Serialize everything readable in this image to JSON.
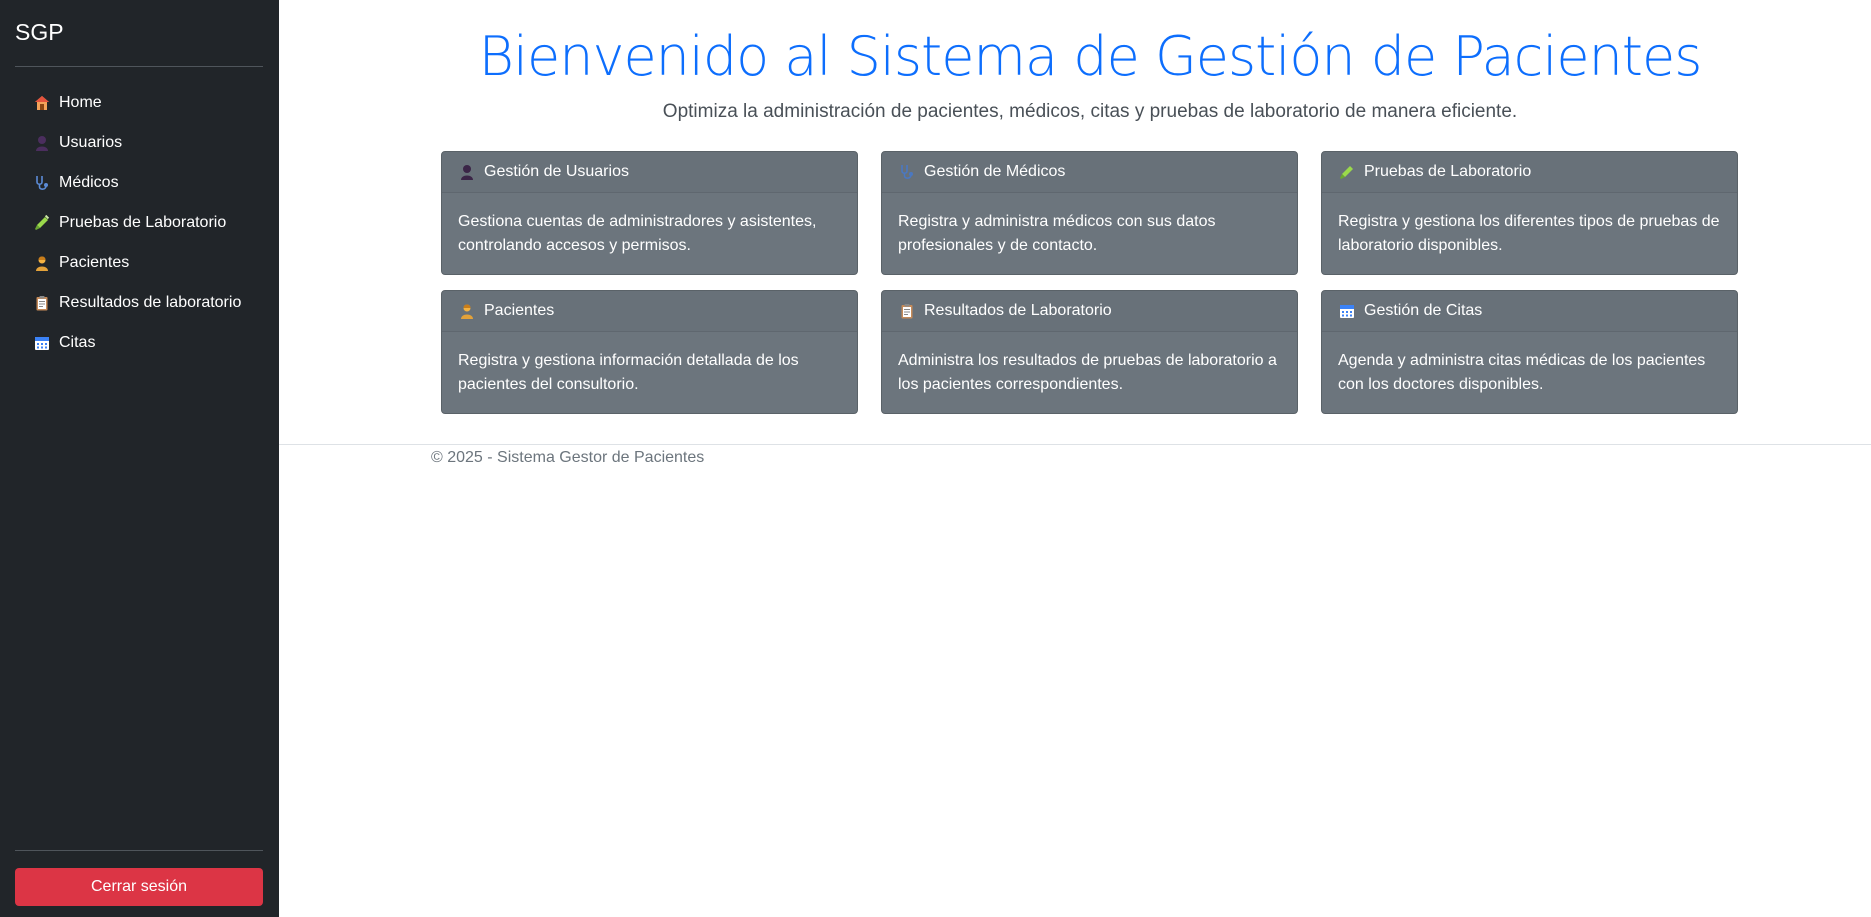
{
  "sidebar": {
    "brand": "SGP",
    "items": [
      {
        "label": "Home",
        "icon": "house-icon"
      },
      {
        "label": "Usuarios",
        "icon": "user-silhouette-icon"
      },
      {
        "label": "Médicos",
        "icon": "stethoscope-icon"
      },
      {
        "label": "Pruebas de Laboratorio",
        "icon": "syringe-icon"
      },
      {
        "label": "Pacientes",
        "icon": "patient-icon"
      },
      {
        "label": "Resultados de laboratorio",
        "icon": "clipboard-icon"
      },
      {
        "label": "Citas",
        "icon": "calendar-icon"
      }
    ],
    "logout_label": "Cerrar sesión"
  },
  "main": {
    "title": "Bienvenido al Sistema de Gestión de Pacientes",
    "subtitle": "Optimiza la administración de pacientes, médicos, citas y pruebas de laboratorio de manera eficiente.",
    "cards": [
      {
        "title": "Gestión de Usuarios",
        "icon": "user-silhouette-icon",
        "text": "Gestiona cuentas de administradores y asistentes, controlando accesos y permisos."
      },
      {
        "title": "Gestión de Médicos",
        "icon": "stethoscope-icon",
        "text": "Registra y administra médicos con sus datos profesionales y de contacto."
      },
      {
        "title": "Pruebas de Laboratorio",
        "icon": "syringe-icon",
        "text": "Registra y gestiona los diferentes tipos de pruebas de laboratorio disponibles."
      },
      {
        "title": "Pacientes",
        "icon": "patient-icon",
        "text": "Registra y gestiona información detallada de los pacientes del consultorio."
      },
      {
        "title": "Resultados de Laboratorio",
        "icon": "clipboard-icon",
        "text": "Administra los resultados de pruebas de laboratorio a los pacientes correspondientes."
      },
      {
        "title": "Gestión de Citas",
        "icon": "calendar-icon",
        "text": "Agenda y administra citas médicas de los pacientes con los doctores disponibles."
      }
    ]
  },
  "footer": {
    "text": "© 2025 - Sistema Gestor de Pacientes"
  },
  "colors": {
    "sidebar_bg": "#212529",
    "title_blue": "#0d6efd",
    "card_bg": "#6c757d",
    "logout_red": "#dc3545"
  }
}
